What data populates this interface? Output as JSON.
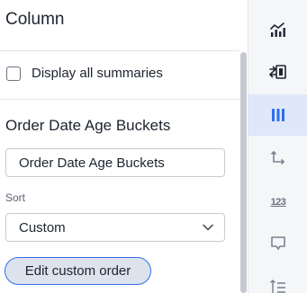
{
  "panel": {
    "title": "Column",
    "display_all_summaries_label": "Display all summaries",
    "display_all_summaries_checked": false,
    "section_title": "Order Date Age Buckets",
    "name_input_value": "Order Date Age Buckets",
    "sort_label": "Sort",
    "sort_selected": "Custom",
    "edit_custom_order_label": "Edit custom order"
  },
  "rail": {
    "icons": [
      {
        "name": "chart-config-icon",
        "active": false
      },
      {
        "name": "swap-columns-icon",
        "active": false
      },
      {
        "name": "column-settings-icon",
        "active": true
      },
      {
        "name": "axis-arrow-icon",
        "active": false
      },
      {
        "name": "number-format-icon",
        "glyph": "123",
        "active": false
      },
      {
        "name": "tooltip-icon",
        "active": false
      },
      {
        "name": "list-settings-icon",
        "active": false
      }
    ],
    "accent_color": "#2f6fed",
    "active_background": "#dfe7f8"
  }
}
